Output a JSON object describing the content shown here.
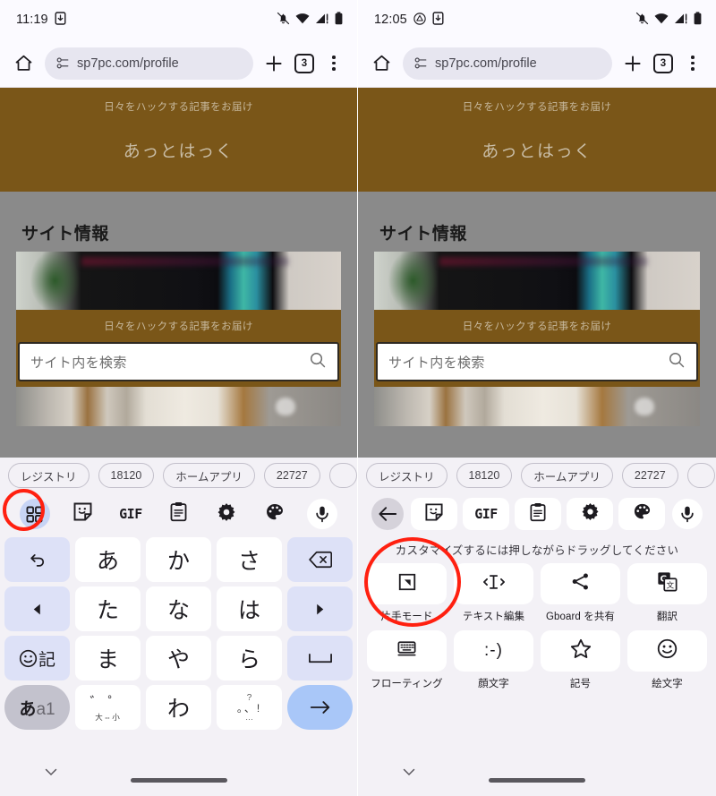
{
  "left": {
    "status": {
      "clock": "11:19",
      "icons": [
        "download-icon",
        "notifications-off-icon",
        "wifi-icon",
        "signal-icon",
        "battery-icon"
      ]
    },
    "browser": {
      "url": "sp7pc.com/profile",
      "tab_count": "3",
      "home_icon": "home-icon",
      "lock_icon": "page-info-icon",
      "new_tab_icon": "plus-icon",
      "overflow_icon": "more-vert-icon"
    },
    "page": {
      "hero_tagline": "日々をハックする記事をお届け",
      "hero_title": "あっとはっく",
      "section_title": "サイト情報",
      "band_text": "日々をハックする記事をお届け",
      "search_placeholder": "サイト内を検索",
      "search_icon": "search-icon"
    },
    "chips": [
      "レジストリ",
      "18120",
      "ホームアプリ",
      "22727"
    ],
    "toolbar": [
      {
        "name": "grid-apps-icon",
        "label": "ツール",
        "active": true
      },
      {
        "name": "sticker-icon",
        "label": "ステッカー",
        "active": false
      },
      {
        "name": "gif-icon",
        "label": "GIF",
        "active": false
      },
      {
        "name": "clipboard-icon",
        "label": "クリップボード",
        "active": false
      },
      {
        "name": "settings-gear-icon",
        "label": "設定",
        "active": false
      },
      {
        "name": "theme-palette-icon",
        "label": "テーマ",
        "active": false
      },
      {
        "name": "microphone-icon",
        "label": "音声入力",
        "active": false
      }
    ],
    "keyboard": {
      "rows": [
        [
          {
            "label": "↺",
            "name": "undo-key",
            "type": "fn"
          },
          {
            "label": "あ",
            "name": "kana-key-a",
            "type": "kana"
          },
          {
            "label": "か",
            "name": "kana-key-ka",
            "type": "kana"
          },
          {
            "label": "さ",
            "name": "kana-key-sa",
            "type": "kana"
          },
          {
            "label": "⌫",
            "name": "backspace-key",
            "type": "fn"
          }
        ],
        [
          {
            "label": "◀",
            "name": "cursor-left-key",
            "type": "fn"
          },
          {
            "label": "た",
            "name": "kana-key-ta",
            "type": "kana"
          },
          {
            "label": "な",
            "name": "kana-key-na",
            "type": "kana"
          },
          {
            "label": "は",
            "name": "kana-key-ha",
            "type": "kana"
          },
          {
            "label": "▶",
            "name": "cursor-right-key",
            "type": "fn"
          }
        ],
        [
          {
            "label": "☺記",
            "name": "emoji-symbol-key",
            "type": "fn"
          },
          {
            "label": "ま",
            "name": "kana-key-ma",
            "type": "kana"
          },
          {
            "label": "や",
            "name": "kana-key-ya",
            "type": "kana"
          },
          {
            "label": "ら",
            "name": "kana-key-ra",
            "type": "kana"
          },
          {
            "label": "␣",
            "name": "space-key",
            "type": "fn"
          }
        ],
        [
          {
            "label": "あa1",
            "name": "input-mode-key",
            "type": "mode"
          },
          {
            "label": "゛゜",
            "sub": "大⇔小",
            "name": "dakuten-key",
            "type": "sub"
          },
          {
            "label": "わ",
            "name": "kana-key-wa",
            "type": "kana"
          },
          {
            "label": "、。?!…",
            "name": "punctuation-key",
            "type": "punct"
          },
          {
            "label": "→",
            "name": "enter-key",
            "type": "enter"
          }
        ]
      ]
    },
    "navbar": {
      "chevron": "chevron-down-icon",
      "pill": "home-gesture-pill"
    },
    "annotation": {
      "target": "grid-apps-icon",
      "color": "#ff2010"
    }
  },
  "right": {
    "status": {
      "clock": "12:05",
      "icons": [
        "drive-icon",
        "download-icon",
        "notifications-off-icon",
        "wifi-icon",
        "signal-icon",
        "battery-icon"
      ]
    },
    "browser": {
      "url": "sp7pc.com/profile",
      "tab_count": "3",
      "home_icon": "home-icon",
      "lock_icon": "page-info-icon",
      "new_tab_icon": "plus-icon",
      "overflow_icon": "more-vert-icon"
    },
    "page": {
      "hero_tagline": "日々をハックする記事をお届け",
      "hero_title": "あっとはっく",
      "section_title": "サイト情報",
      "band_text": "日々をハックする記事をお届け",
      "search_placeholder": "サイト内を検索",
      "search_icon": "search-icon"
    },
    "chips": [
      "レジストリ",
      "18120",
      "ホームアプリ",
      "22727"
    ],
    "toolbar": [
      {
        "name": "back-arrow-icon",
        "label": "戻る",
        "style": "back"
      },
      {
        "name": "sticker-icon",
        "label": "ステッカー",
        "style": "pill"
      },
      {
        "name": "gif-icon",
        "label": "GIF",
        "style": "pill"
      },
      {
        "name": "clipboard-icon",
        "label": "クリップボード",
        "style": "pill"
      },
      {
        "name": "settings-gear-icon",
        "label": "設定",
        "style": "pill"
      },
      {
        "name": "theme-palette-icon",
        "label": "テーマ",
        "style": "pill"
      },
      {
        "name": "microphone-icon",
        "label": "音声入力",
        "style": "mic"
      }
    ],
    "menu": {
      "hint": "カスタマイズするには押しながらドラッグしてください",
      "items": [
        {
          "label": "片手モード",
          "icon": "one-handed-mode-icon"
        },
        {
          "label": "テキスト編集",
          "icon": "text-editing-icon"
        },
        {
          "label": "Gboard を共有",
          "icon": "share-icon"
        },
        {
          "label": "翻訳",
          "icon": "translate-icon"
        },
        {
          "label": "フローティング",
          "icon": "floating-keyboard-icon"
        },
        {
          "label": "顔文字",
          "icon": "kaomoji-icon"
        },
        {
          "label": "記号",
          "icon": "symbols-star-icon"
        },
        {
          "label": "絵文字",
          "icon": "emoji-smiley-icon"
        }
      ]
    },
    "navbar": {
      "chevron": "chevron-down-icon",
      "pill": "home-gesture-pill"
    },
    "annotation": {
      "target": "one-handed-mode-icon",
      "color": "#ff2010"
    }
  }
}
